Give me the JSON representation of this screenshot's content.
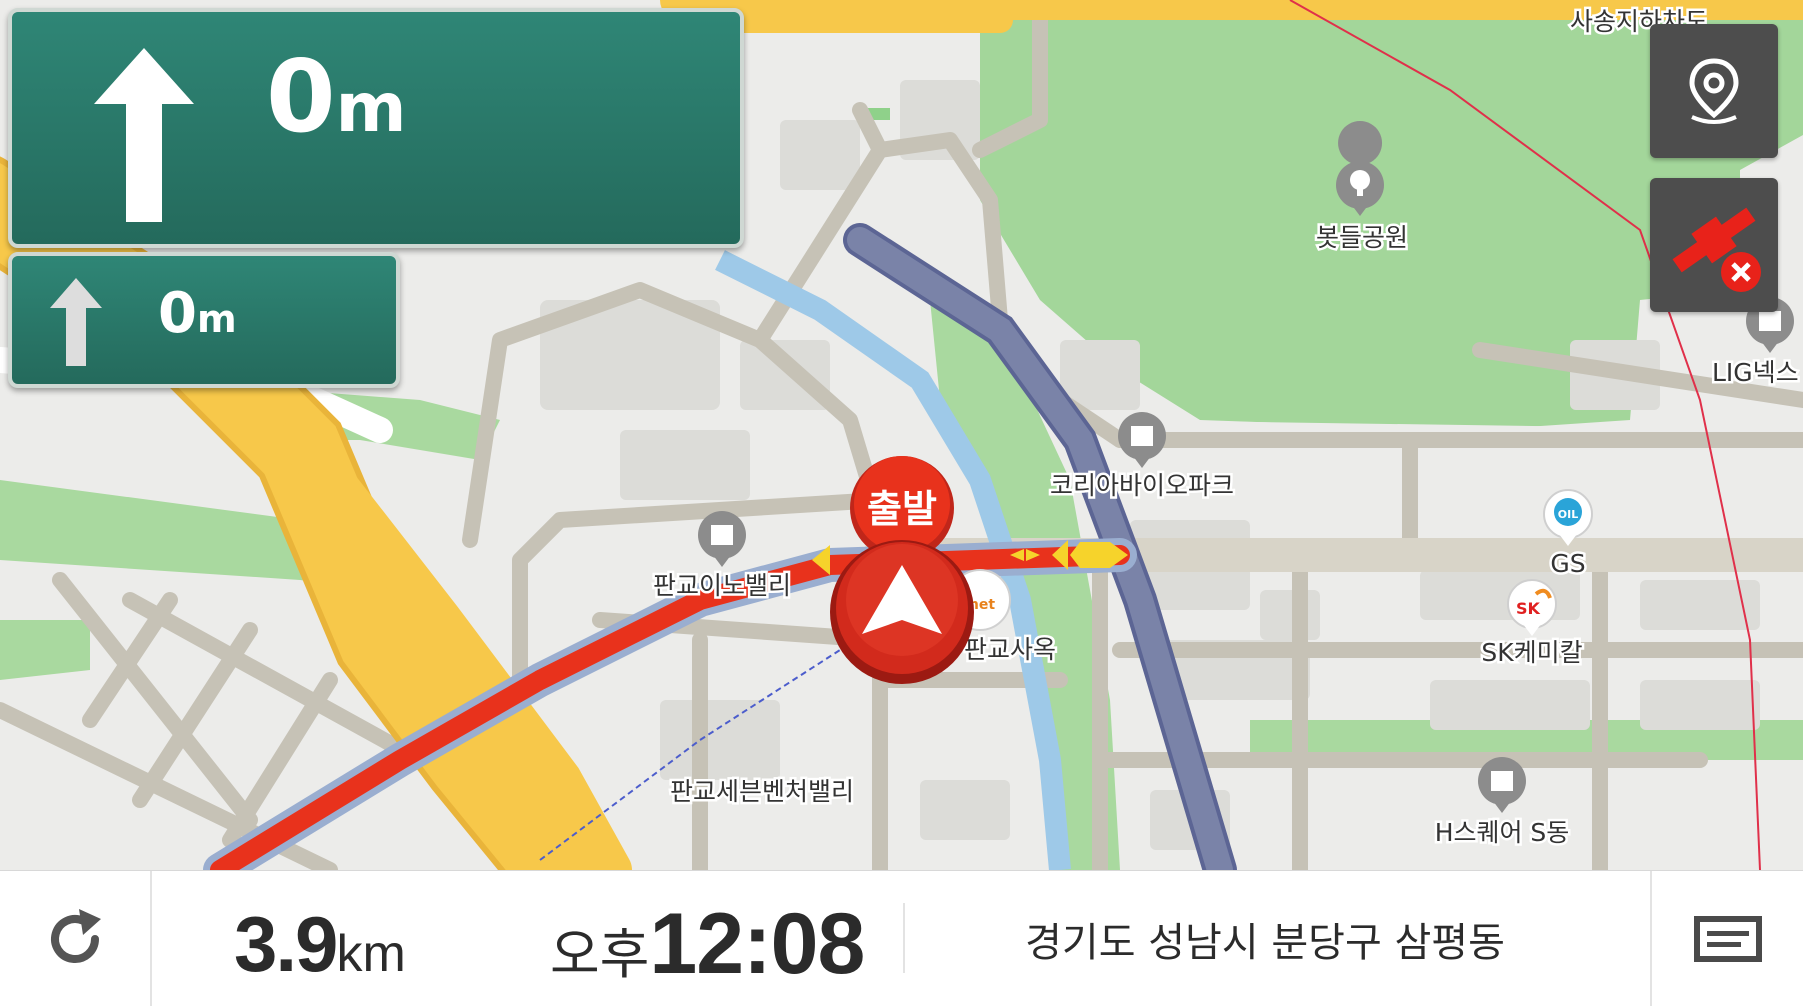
{
  "guidance": {
    "main_distance": "0",
    "main_unit": "m",
    "main_direction": "straight-arrow",
    "next_distance": "0",
    "next_unit": "m",
    "next_direction": "straight-arrow"
  },
  "map": {
    "start_marker": "출발",
    "labels": {
      "sasong": "사송지하차도",
      "park": "봇들공원",
      "korea_bio_park": "코리아바이오파크",
      "pangyo_innovalley": "판교이노밸리",
      "pangyo_office": "판교사옥",
      "pangyo_seven_venture": "판교세븐벤처밸리",
      "gs": "GS",
      "sk_chemical": "SK케미칼",
      "lig": "LIG넥스",
      "h_square": "H스퀘어 S동",
      "gs_badge": "OIL",
      "sk_badge": "SK",
      "net_fragment": "net"
    }
  },
  "side_buttons": {
    "location_icon": "location-pin-icon",
    "gps_icon": "gps-disconnected-icon"
  },
  "bottom_bar": {
    "refresh_icon": "refresh-icon",
    "distance_value": "3.9",
    "distance_unit": "km",
    "eta_ampm": "오후",
    "eta_time": "12:08",
    "address": "경기도 성남시 분당구 삼평동",
    "menu_icon": "menu-icon"
  },
  "colors": {
    "route": "#e8321c",
    "park_green": "#a3d69a",
    "road_yellow": "#f7c84a",
    "expressway": "#7a83a8",
    "sign_green": "#2a7466"
  }
}
